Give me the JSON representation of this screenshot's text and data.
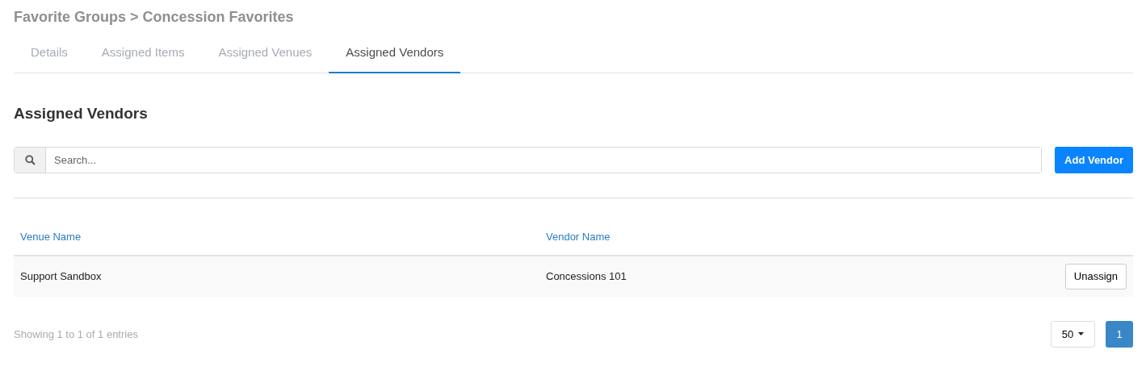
{
  "breadcrumb": {
    "title": "Favorite Groups > Concession Favorites"
  },
  "tabs": [
    {
      "label": "Details",
      "selected": false
    },
    {
      "label": "Assigned Items",
      "selected": false
    },
    {
      "label": "Assigned Venues",
      "selected": false
    },
    {
      "label": "Assigned Vendors",
      "selected": true
    }
  ],
  "section_title": "Assigned Vendors",
  "search": {
    "placeholder": "Search..."
  },
  "add_button": "Add Vendor",
  "table": {
    "columns": [
      "Venue Name",
      "Vendor Name"
    ],
    "rows": [
      {
        "cells": [
          "Support Sandbox",
          "Concessions 101"
        ],
        "action": "Unassign"
      }
    ]
  },
  "footer": {
    "info": "Showing 1 to 1 of 1 entries",
    "page_size": "50",
    "pages": [
      {
        "label": "1",
        "selected": true
      }
    ]
  }
}
